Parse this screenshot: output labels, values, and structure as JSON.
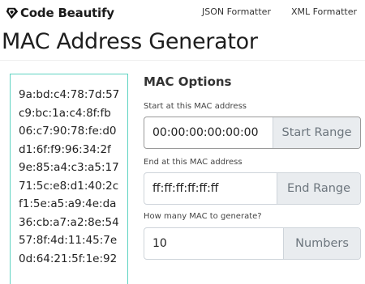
{
  "header": {
    "brand": "Code Beautify",
    "logo_icon": "diamond-logo-icon",
    "nav": [
      "JSON Formatter",
      "XML Formatter"
    ]
  },
  "page_title": "MAC Address Generator",
  "mac_list": [
    "9a:bd:c4:78:7d:57",
    "c9:bc:1a:c4:8f:fb",
    "06:c7:90:78:fe:d0",
    "d1:6f:f9:96:34:2f",
    "9e:85:a4:c3:a5:17",
    "71:5c:e8:d1:40:2c",
    "f1:5e:a5:a9:4e:da",
    "36:cb:a7:a2:8e:54",
    "57:8f:4d:11:45:7e",
    "0d:64:21:5f:1e:92"
  ],
  "options": {
    "title": "MAC Options",
    "start": {
      "label": "Start at this MAC address",
      "value": "00:00:00:00:00:00",
      "addon": "Start Range"
    },
    "end": {
      "label": "End at this MAC address",
      "value": "ff:ff:ff:ff:ff:ff",
      "addon": "End Range"
    },
    "count": {
      "label": "How many MAC to generate?",
      "value": "10",
      "addon": "Numbers"
    }
  },
  "colors": {
    "list_border": "#5fd3c2",
    "addon_bg": "#e9ecef"
  }
}
